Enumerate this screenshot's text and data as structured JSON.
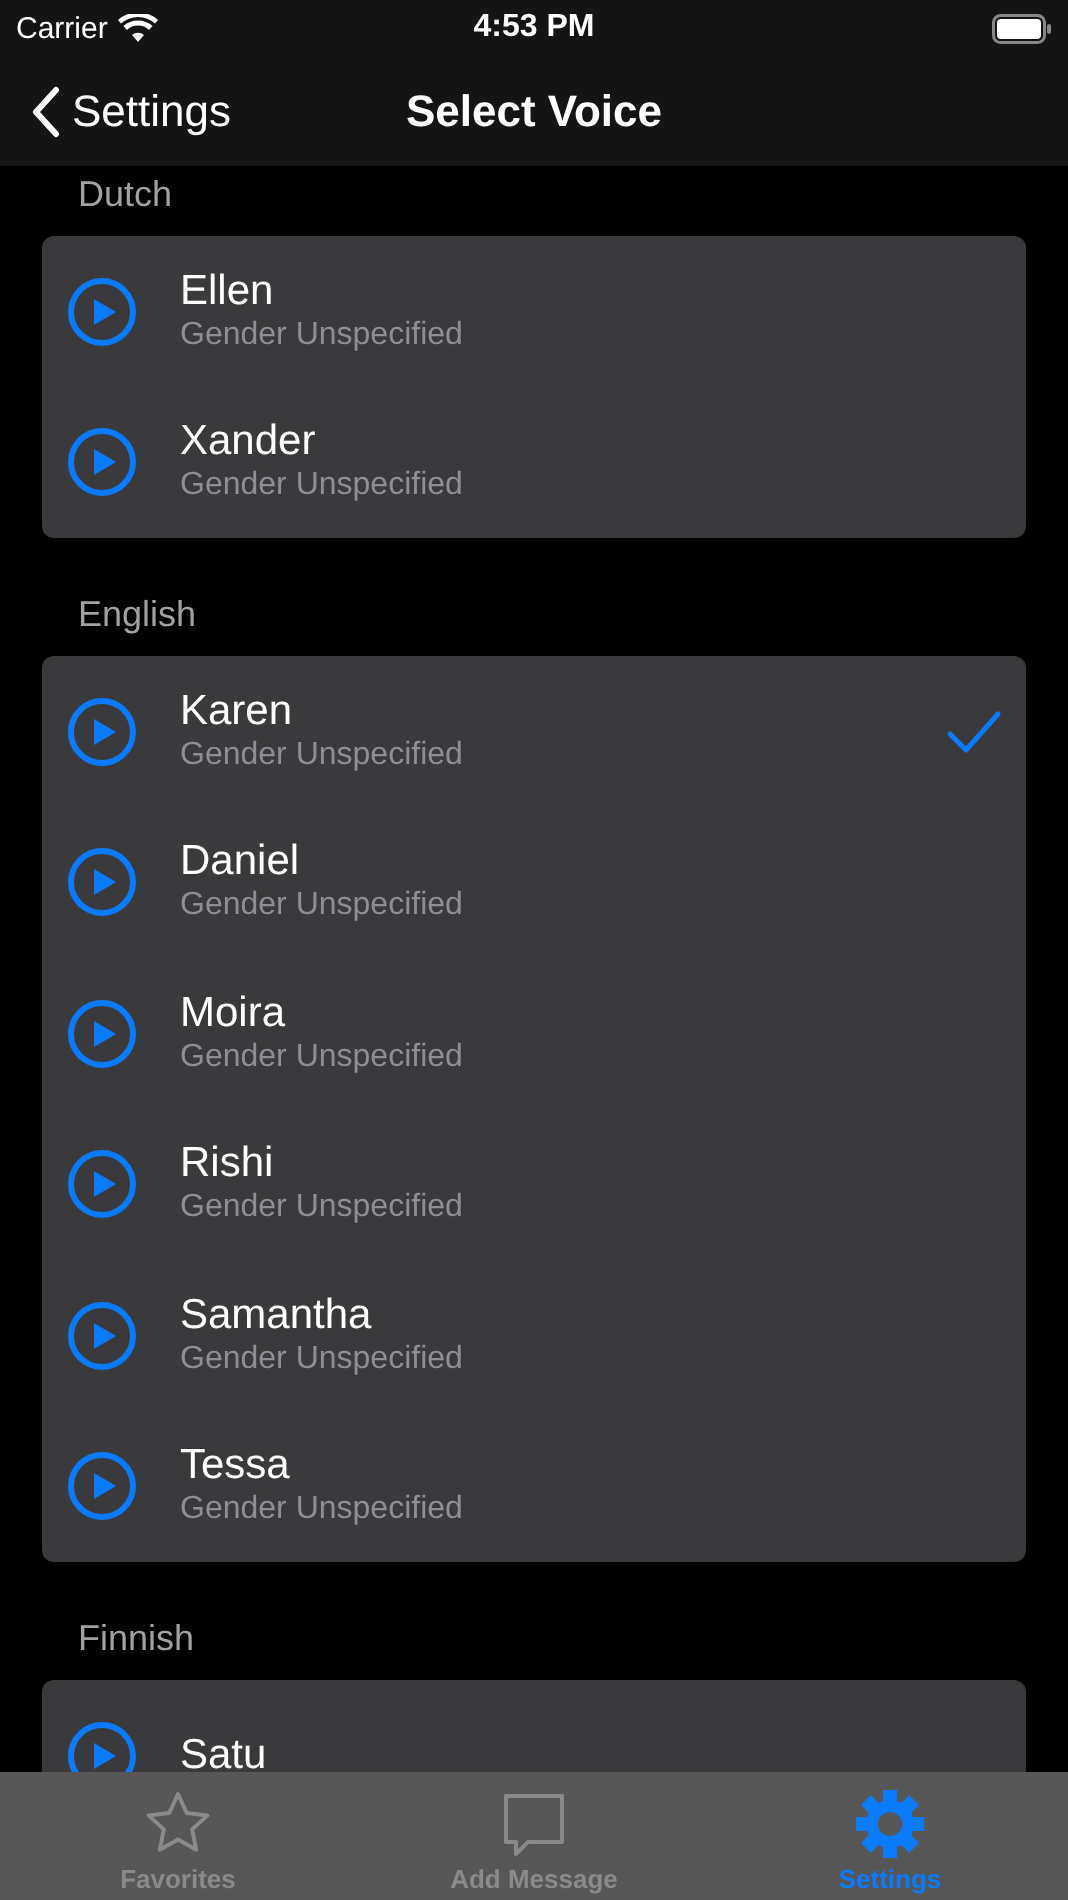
{
  "status_bar": {
    "carrier": "Carrier",
    "time": "4:53 PM"
  },
  "nav": {
    "back": "Settings",
    "title": "Select Voice"
  },
  "sections": [
    {
      "header": "Dutch",
      "voices": [
        {
          "name": "Ellen",
          "detail": "Gender Unspecified",
          "selected": false
        },
        {
          "name": "Xander",
          "detail": "Gender Unspecified",
          "selected": false
        }
      ]
    },
    {
      "header": "English",
      "voices": [
        {
          "name": "Karen",
          "detail": "Gender Unspecified",
          "selected": true
        },
        {
          "name": "Daniel",
          "detail": "Gender Unspecified",
          "selected": false
        },
        {
          "name": "Moira",
          "detail": "Gender Unspecified",
          "selected": false
        },
        {
          "name": "Rishi",
          "detail": "Gender Unspecified",
          "selected": false
        },
        {
          "name": "Samantha",
          "detail": "Gender Unspecified",
          "selected": false
        },
        {
          "name": "Tessa",
          "detail": "Gender Unspecified",
          "selected": false
        }
      ]
    },
    {
      "header": "Finnish",
      "voices": [
        {
          "name": "Satu",
          "selected": false
        }
      ]
    }
  ],
  "tabs": [
    {
      "label": "Favorites",
      "kind": "star",
      "selected": false
    },
    {
      "label": "Add Message",
      "kind": "message",
      "selected": false
    },
    {
      "label": "Settings",
      "kind": "gear",
      "selected": true
    }
  ]
}
